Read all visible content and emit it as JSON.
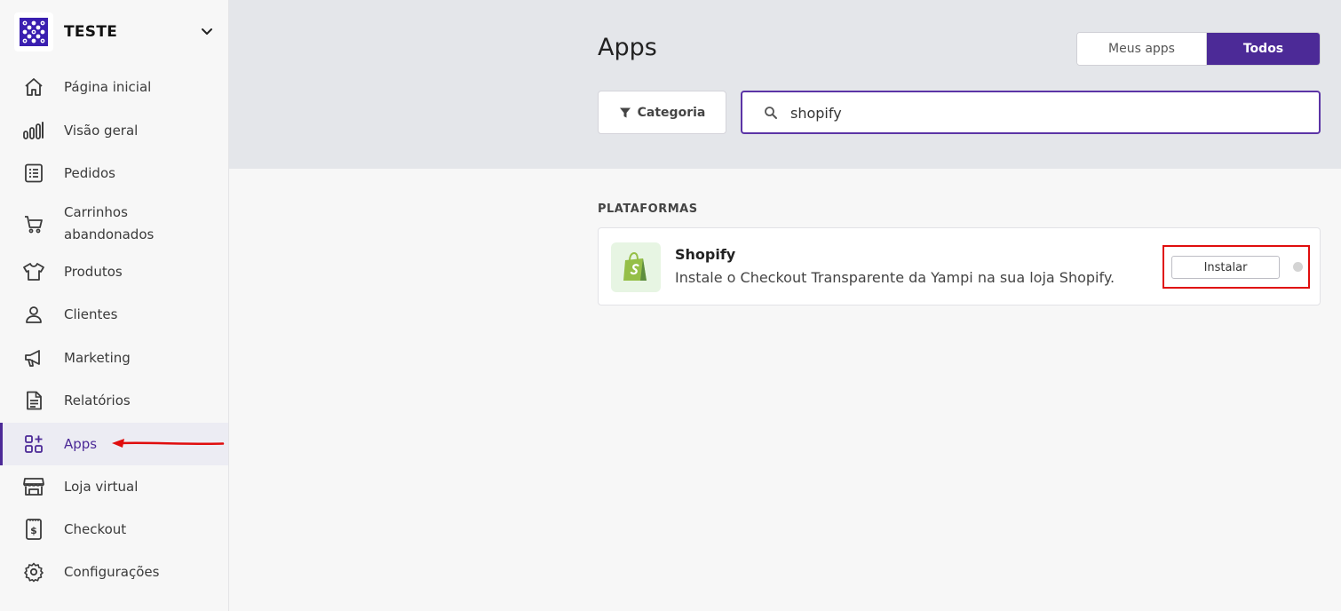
{
  "store": {
    "name": "TESTE"
  },
  "sidebar": {
    "items": [
      {
        "label": "Página inicial",
        "icon": "home-icon"
      },
      {
        "label": "Visão geral",
        "icon": "bar-chart-icon"
      },
      {
        "label": "Pedidos",
        "icon": "list-icon"
      },
      {
        "label": "Carrinhos abandonados",
        "icon": "cart-icon"
      },
      {
        "label": "Produtos",
        "icon": "shirt-icon"
      },
      {
        "label": "Clientes",
        "icon": "user-icon"
      },
      {
        "label": "Marketing",
        "icon": "megaphone-icon"
      },
      {
        "label": "Relatórios",
        "icon": "report-icon"
      },
      {
        "label": "Apps",
        "icon": "apps-icon",
        "active": true
      },
      {
        "label": "Loja virtual",
        "icon": "storefront-icon"
      },
      {
        "label": "Checkout",
        "icon": "checkout-icon"
      },
      {
        "label": "Configurações",
        "icon": "gear-icon"
      }
    ]
  },
  "header": {
    "title": "Apps",
    "toggle": {
      "my_apps": "Meus apps",
      "all": "Todos",
      "selected": "Todos"
    },
    "category_button": "Categoria",
    "search": {
      "value": "shopify"
    }
  },
  "section": {
    "title": "PLATAFORMAS",
    "apps": [
      {
        "name": "Shopify",
        "description": "Instale o Checkout Transparente da Yampi na sua loja Shopify.",
        "action": "Instalar",
        "icon": "shopify-bag-icon"
      }
    ]
  },
  "colors": {
    "accent": "#4c2a97",
    "highlight": "#e00d0d",
    "header_bg": "#e4e6ea",
    "shopify_green": "#95bf47"
  }
}
